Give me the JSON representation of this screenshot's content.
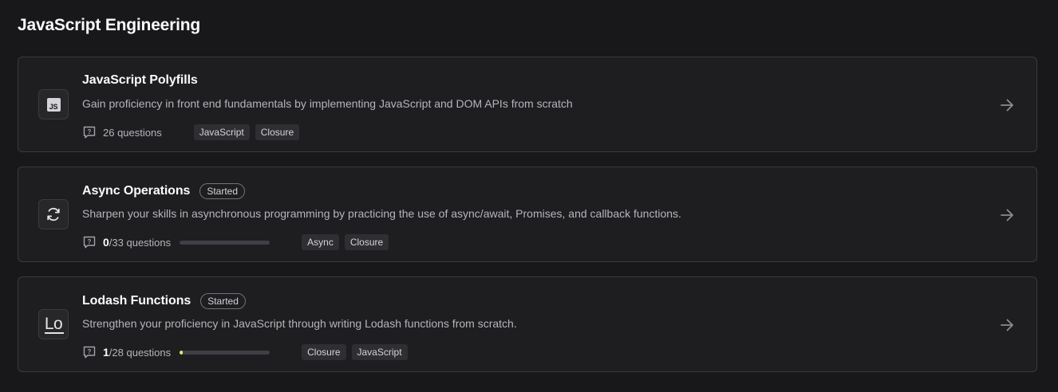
{
  "section": {
    "title": "JavaScript Engineering"
  },
  "colors": {
    "background": "#18181b",
    "card": "#1e1e21",
    "border": "#3a3a3f",
    "progress": "#c7f36b"
  },
  "cards": [
    {
      "title": "JavaScript Polyfills",
      "icon": "js-logo-icon",
      "icon_text": "JS",
      "description": "Gain proficiency in front end fundamentals by implementing JavaScript and DOM APIs from scratch",
      "questions_text": "26 questions",
      "tags": [
        "JavaScript",
        "Closure"
      ]
    },
    {
      "title": "Async Operations",
      "status": "Started",
      "icon": "async-refresh-icon",
      "description": "Sharpen your skills in asynchronous programming by practicing the use of async/await, Promises, and callback functions.",
      "completed": "0",
      "total_text": "/33 questions",
      "progress": 0.0,
      "tags": [
        "Async",
        "Closure"
      ]
    },
    {
      "title": "Lodash Functions",
      "status": "Started",
      "icon": "lodash-logo-icon",
      "icon_text": "Lo",
      "description": "Strengthen your proficiency in JavaScript through writing Lodash functions from scratch.",
      "completed": "1",
      "total_text": "/28 questions",
      "progress": 0.036,
      "tags": [
        "Closure",
        "JavaScript"
      ]
    }
  ]
}
